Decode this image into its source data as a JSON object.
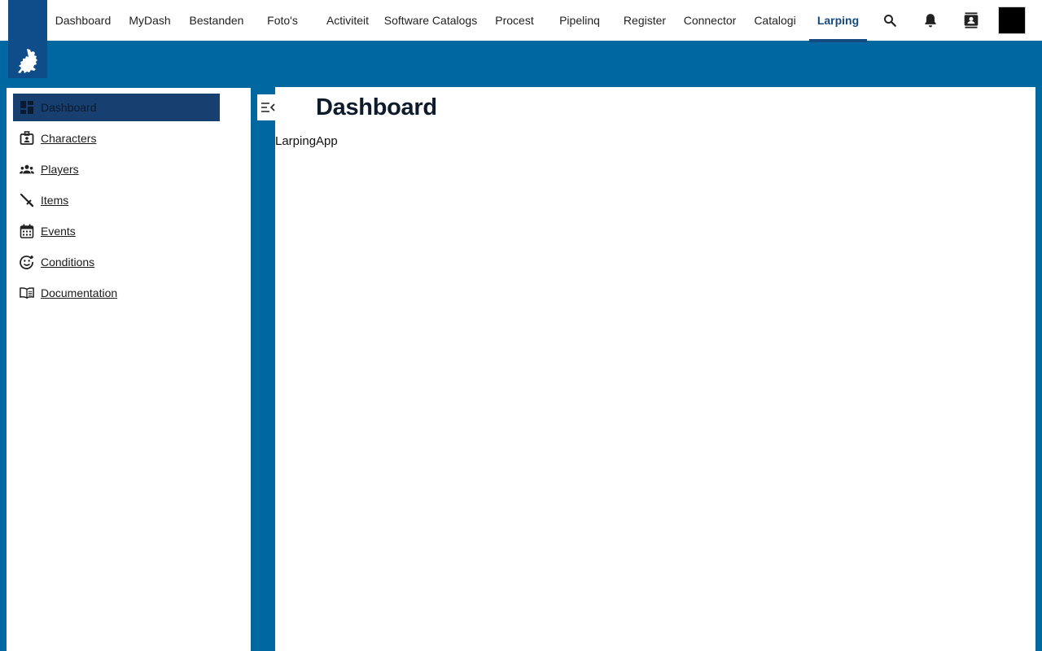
{
  "topnav": {
    "items": [
      {
        "label": "Dashboard"
      },
      {
        "label": "MyDash"
      },
      {
        "label": "Bestanden"
      },
      {
        "label": "Foto's"
      },
      {
        "label": "Activiteit"
      },
      {
        "label": "Software Catalogs"
      },
      {
        "label": "Procest"
      },
      {
        "label": "Pipelinq"
      },
      {
        "label": "Register"
      },
      {
        "label": "Connector"
      },
      {
        "label": "Catalogi"
      },
      {
        "label": "Larping"
      }
    ],
    "active": "Larping",
    "icons": [
      "search-icon",
      "bell-icon",
      "contacts-icon"
    ]
  },
  "sidebar": {
    "items": [
      {
        "label": "Dashboard",
        "icon": "dashboard-icon"
      },
      {
        "label": "Characters",
        "icon": "badge-icon"
      },
      {
        "label": "Players",
        "icon": "people-icon"
      },
      {
        "label": "Items",
        "icon": "sword-icon"
      },
      {
        "label": "Events",
        "icon": "calendar-icon"
      },
      {
        "label": "Conditions",
        "icon": "face-icon"
      },
      {
        "label": "Documentation",
        "icon": "book-icon"
      }
    ],
    "active": "Dashboard"
  },
  "main": {
    "title": "Dashboard",
    "app_name": "LarpingApp"
  },
  "colors": {
    "brand": "#0067a1",
    "logo_bg": "#0f4d8a",
    "active_bg": "#173f70",
    "active_text": "#154a80"
  }
}
